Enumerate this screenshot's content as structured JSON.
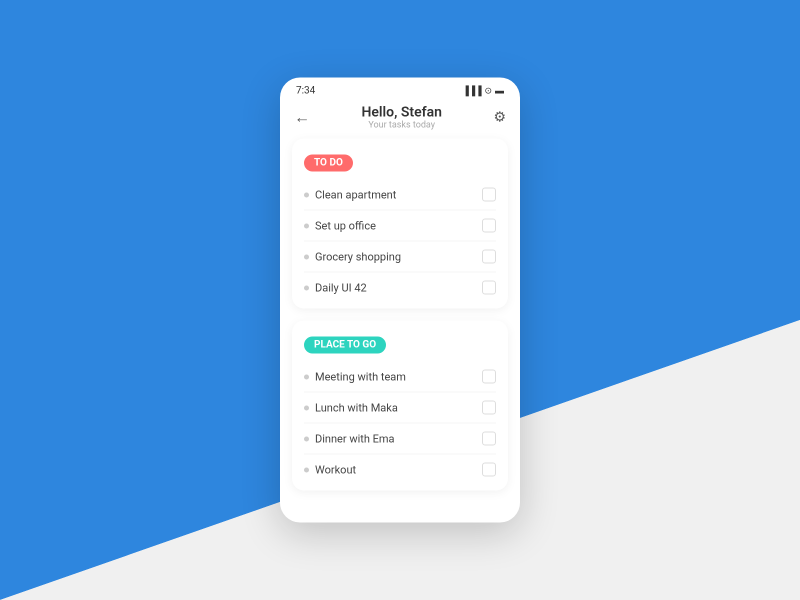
{
  "background": {
    "blue_color": "#2E86DE",
    "white_color": "#f0f0f0"
  },
  "status_bar": {
    "time": "7:34",
    "icons": "▐▐▐ ⊙ ▪▪"
  },
  "header": {
    "back_label": "←",
    "title": "Hello, Stefan",
    "subtitle": "Your tasks today",
    "gear_icon": "⚙"
  },
  "sections": [
    {
      "id": "todo",
      "badge_label": "TO DO",
      "badge_class": "badge-todo",
      "tasks": [
        {
          "label": "Clean apartment"
        },
        {
          "label": "Set up office"
        },
        {
          "label": "Grocery shopping"
        },
        {
          "label": "Daily UI 42"
        }
      ]
    },
    {
      "id": "place-to-go",
      "badge_label": "PLACE TO GO",
      "badge_class": "badge-place",
      "tasks": [
        {
          "label": "Meeting with team"
        },
        {
          "label": "Lunch with Maka"
        },
        {
          "label": "Dinner with Ema"
        },
        {
          "label": "Workout"
        }
      ]
    }
  ]
}
